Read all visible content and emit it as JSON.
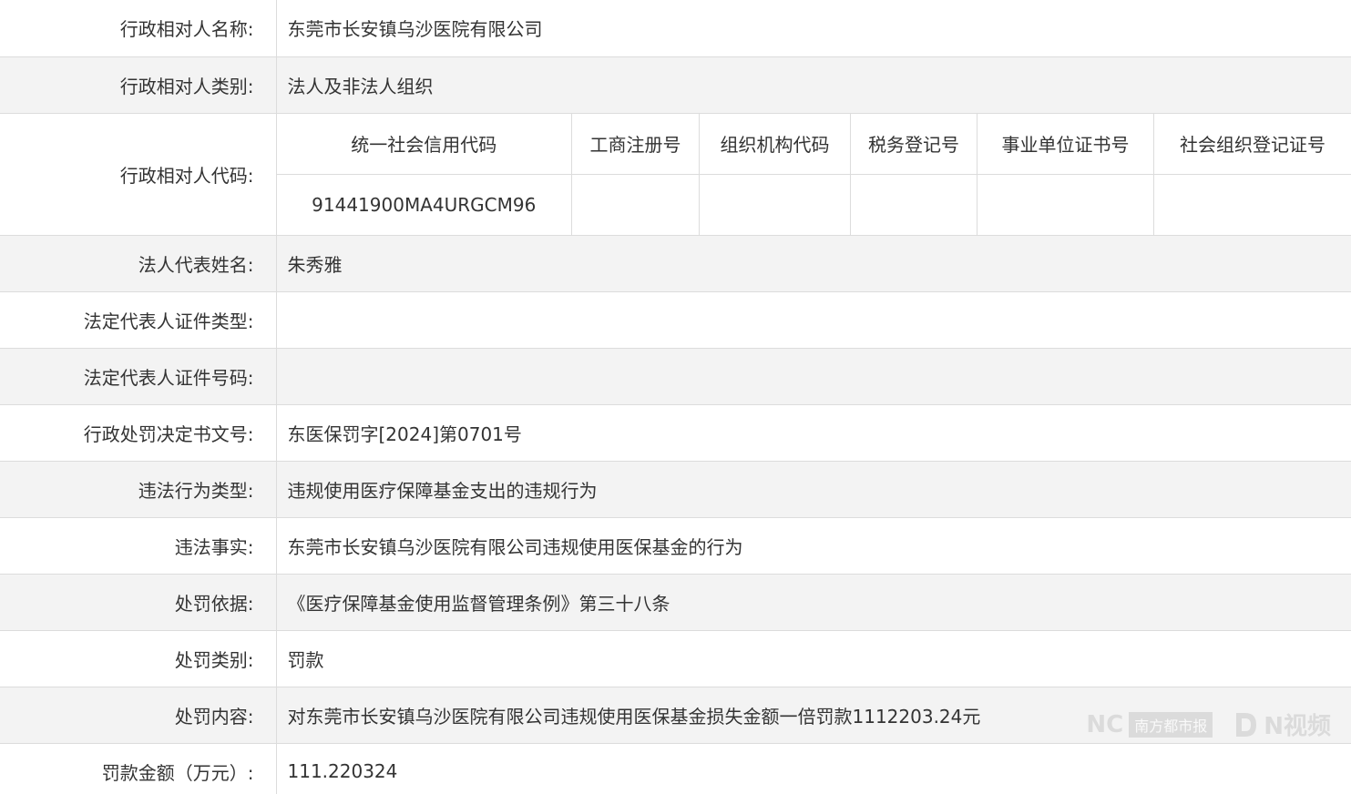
{
  "rows": [
    {
      "label": "行政相对人名称:",
      "value": "东莞市长安镇乌沙医院有限公司"
    },
    {
      "label": "行政相对人类别:",
      "value": "法人及非法人组织"
    },
    {
      "label": "行政相对人代码:",
      "value": ""
    },
    {
      "label": "法人代表姓名:",
      "value": "朱秀雅"
    },
    {
      "label": "法定代表人证件类型:",
      "value": ""
    },
    {
      "label": "法定代表人证件号码:",
      "value": ""
    },
    {
      "label": "行政处罚决定书文号:",
      "value": "东医保罚字[2024]第0701号"
    },
    {
      "label": "违法行为类型:",
      "value": "违规使用医疗保障基金支出的违规行为"
    },
    {
      "label": "违法事实:",
      "value": "东莞市长安镇乌沙医院有限公司违规使用医保基金的行为"
    },
    {
      "label": "处罚依据:",
      "value": "《医疗保障基金使用监督管理条例》第三十八条"
    },
    {
      "label": "处罚类别:",
      "value": "罚款"
    },
    {
      "label": "处罚内容:",
      "value": "对东莞市长安镇乌沙医院有限公司违规使用医保基金损失金额一倍罚款1112203.24元"
    },
    {
      "label": "罚款金额（万元）:",
      "value": "111.220324"
    }
  ],
  "codes": {
    "headers": [
      "统一社会信用代码",
      "工商注册号",
      "组织机构代码",
      "税务登记号",
      "事业单位证书号",
      "社会组织登记证号"
    ],
    "values": [
      "91441900MA4URGCM96",
      "",
      "",
      "",
      "",
      ""
    ]
  },
  "watermark": {
    "brand_mark": "NC",
    "brand_tag": "南方都市报",
    "video_mark": "N视频"
  }
}
